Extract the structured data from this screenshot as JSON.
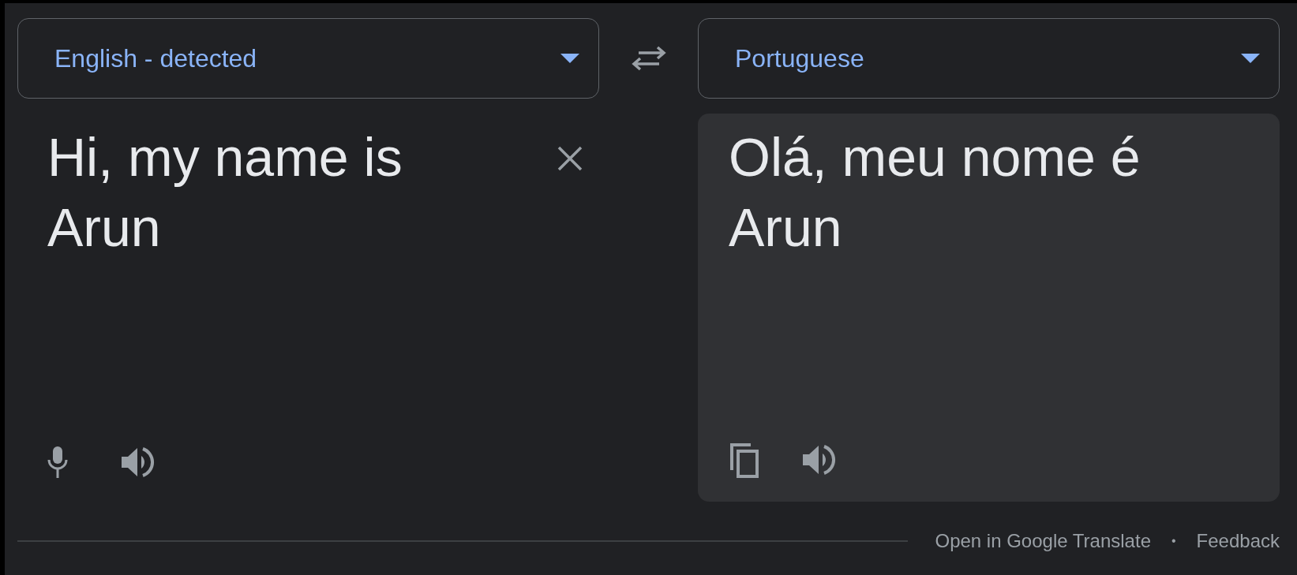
{
  "source": {
    "language": "English - detected",
    "text": "Hi, my name is\nArun"
  },
  "target": {
    "language": "Portuguese",
    "text": "Olá, meu nome é\nArun"
  },
  "footer": {
    "links": [
      "Open in Google Translate",
      "Feedback"
    ],
    "separator": "•"
  }
}
